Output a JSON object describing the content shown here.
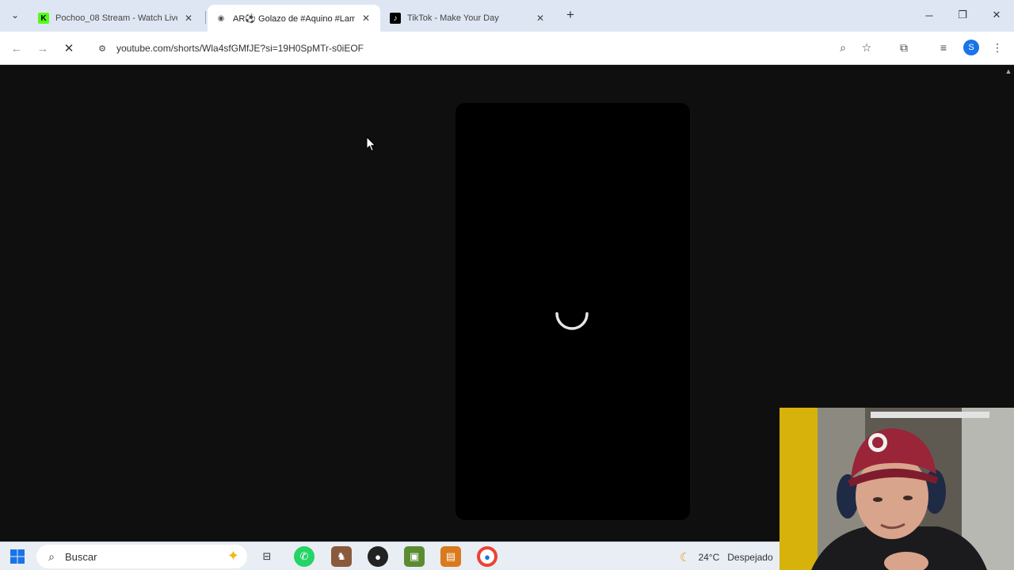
{
  "browser": {
    "tabs": [
      {
        "title": "Pochoo_08 Stream - Watch Live",
        "icon": "kick-icon",
        "active": false
      },
      {
        "title": "AR⚽ Golazo de #Aquino #Lam",
        "icon": "audio-icon",
        "active": true
      },
      {
        "title": "TikTok - Make Your Day",
        "icon": "tiktok-icon",
        "active": false
      }
    ],
    "address_bar": {
      "url": "youtube.com/shorts/Wla4sfGMfJE?si=19H0SpMTr-s0iEOF"
    },
    "profile_initial": "S"
  },
  "page": {
    "player_state": "loading"
  },
  "taskbar": {
    "search_placeholder": "Buscar",
    "weather_temp": "24°C",
    "weather_text": "Despejado",
    "apps": [
      "task-view",
      "whatsapp",
      "game",
      "roblox",
      "minecraft",
      "game2",
      "chrome"
    ]
  },
  "colors": {
    "tabstrip_bg": "#dfe6f3",
    "page_bg": "#0f0f0f",
    "player_bg": "#000000",
    "accent_blue": "#1a73e8"
  }
}
